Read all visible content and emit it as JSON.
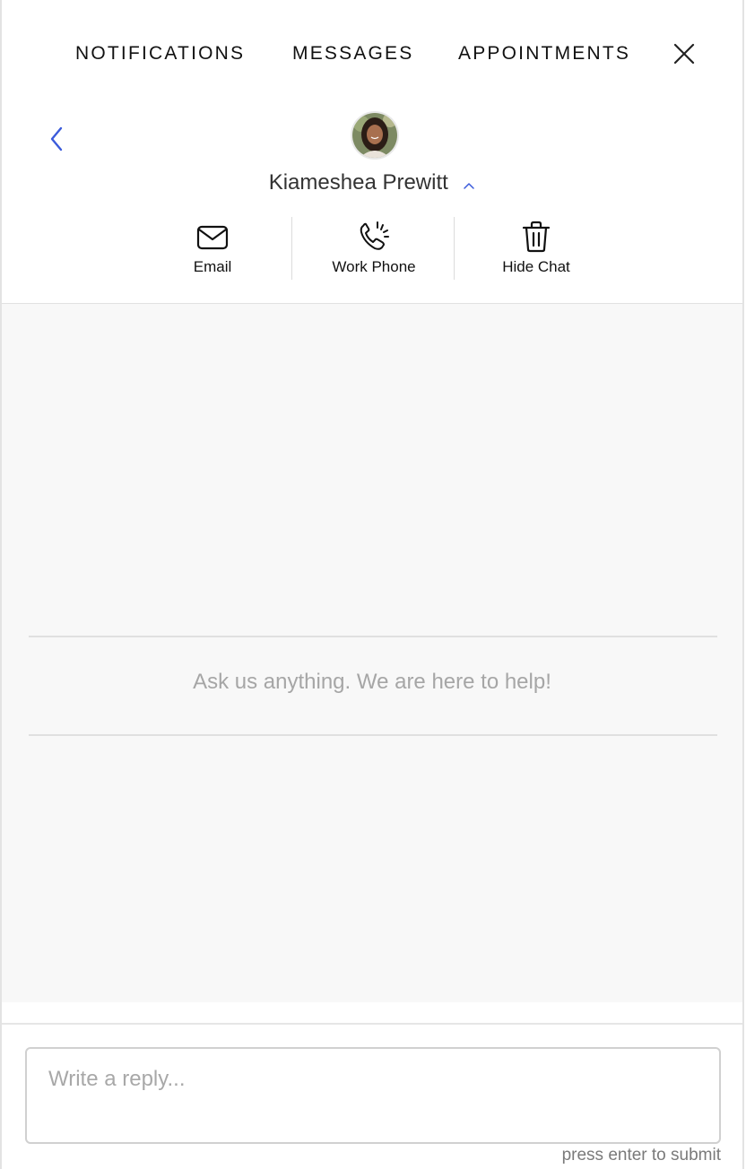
{
  "nav": {
    "tabs": [
      {
        "label": "NOTIFICATIONS"
      },
      {
        "label": "MESSAGES"
      },
      {
        "label": "APPOINTMENTS"
      }
    ],
    "close_icon": "close-icon"
  },
  "contact": {
    "name": "Kiameshea Prewitt",
    "avatar": "avatar-photo",
    "back_icon": "chevron-left-icon",
    "expand_icon": "chevron-up-icon"
  },
  "actions": [
    {
      "label": "Email",
      "icon": "envelope-icon"
    },
    {
      "label": "Work Phone",
      "icon": "phone-icon"
    },
    {
      "label": "Hide Chat",
      "icon": "trash-icon"
    }
  ],
  "chat": {
    "empty_message": "Ask us anything. We are here to help!"
  },
  "composer": {
    "placeholder": "Write a reply...",
    "value": "",
    "hint": "press enter to submit"
  },
  "colors": {
    "accent": "#3b5bdb",
    "chat_bg": "#f8f8f8",
    "text": "#111111",
    "muted": "#a6a6a6"
  }
}
